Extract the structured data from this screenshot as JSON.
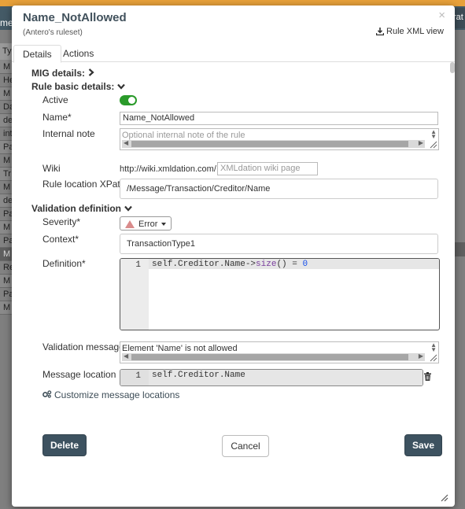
{
  "background": {
    "header_text": "me",
    "right_btn_text": "rat",
    "table_header": "Ty",
    "rows": [
      "M",
      "He",
      "M",
      "Da",
      "de",
      "int",
      "Pa",
      "M",
      "Tr",
      "M",
      "de",
      "Pa",
      "M",
      "Pa",
      "M",
      "Re",
      "M",
      "Pa",
      "M"
    ],
    "highlight_row_index": 14
  },
  "dialog": {
    "title": "Name_NotAllowed",
    "subtitle": "(Antero's ruleset)",
    "close_glyph": "×",
    "xml_view_label": "Rule XML view",
    "tabs": [
      "Details",
      "Actions"
    ],
    "active_tab": "Details"
  },
  "form": {
    "mig_details": "MIG details:",
    "rule_basic_details": "Rule basic details:",
    "active_label": "Active",
    "active_on": true,
    "name_label": "Name*",
    "name_value": "Name_NotAllowed",
    "internal_note_label": "Internal note",
    "internal_note_placeholder": "Optional internal note of the rule",
    "wiki_label": "Wiki",
    "wiki_prefix": "http://wiki.xmldation.com/",
    "wiki_placeholder": "XMLdation wiki page",
    "xpath_label": "Rule location XPath",
    "xpath_value": "/Message/Transaction/Creditor/Name",
    "validation_definition": "Validation definition",
    "severity_label": "Severity*",
    "severity_value": "Error",
    "context_label": "Context*",
    "context_value": "TransactionType1",
    "definition_label": "Definition*",
    "definition_line_no": "1",
    "definition_code": {
      "part1": "self.Creditor.Name->",
      "fn": "size",
      "part2": "() = ",
      "num": "0"
    },
    "validation_message_label": "Validation message*",
    "validation_message_value": "Element 'Name' is not allowed",
    "message_location_label": "Message location",
    "message_location_line_no": "1",
    "message_location_code": "self.Creditor.Name",
    "customize_label": "Customize message locations"
  },
  "buttons": {
    "delete": "Delete",
    "cancel": "Cancel",
    "save": "Save"
  },
  "icons": {
    "expand": "chevron-right-icon",
    "collapse": "chevron-down-icon",
    "download": "download-icon",
    "gears": "gears-icon",
    "trash": "trash-icon",
    "warning": "warning-triangle-icon"
  }
}
